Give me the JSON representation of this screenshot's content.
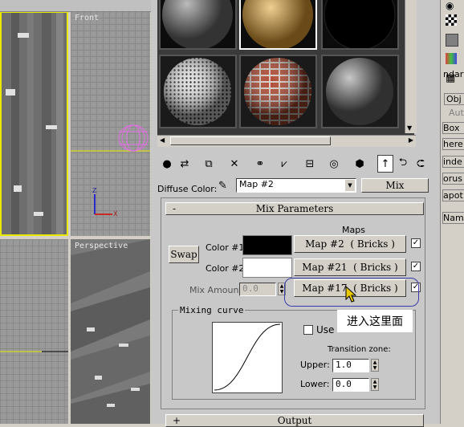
{
  "viewports": {
    "front_label": "Front",
    "perspective_label": "Perspective",
    "axis_z": "Z",
    "axis_x": "X"
  },
  "material_editor": {
    "slots": [
      {
        "name": "stone-sphere"
      },
      {
        "name": "wood-sphere"
      },
      {
        "name": "black-sphere"
      },
      {
        "name": "dotted-sphere"
      },
      {
        "name": "brick-sphere"
      },
      {
        "name": "gray-sphere"
      }
    ],
    "diffuse_label": "Diffuse Color:",
    "diffuse_value": "Map #2",
    "map_type_button": "Mix"
  },
  "rollout": {
    "title": "Mix Parameters",
    "collapse_symbol": "-",
    "maps_header": "Maps",
    "swap_label": "Swap",
    "color1_label": "Color #1",
    "color1_map": "Map #2  ( Bricks )",
    "color1_swatch": "#000000",
    "color2_label": "Color #2",
    "color2_map": "Map #21  ( Bricks )",
    "color2_swatch": "#ffffff",
    "mix_amount_label": "Mix Amount:",
    "mix_amount_value": "0.0",
    "mix_map": "Map #17  ( Bricks )",
    "mixing_curve_label": "Mixing curve",
    "use_curve_label": "Use",
    "annotation": "进入这里面",
    "transition_label": "Transition zone:",
    "upper_label": "Upper:",
    "upper_value": "1.0",
    "lower_label": "Lower:",
    "lower_value": "0.0",
    "output_title": "Output",
    "output_symbol": "+"
  },
  "right_panel": {
    "items": [
      "ndar",
      "Obj",
      "Aut",
      "Box",
      "here",
      "inde",
      "orus",
      "apot",
      "Name"
    ]
  },
  "colors": {
    "annotation_ring": "#3a3aaa",
    "selection_yellow": "#e8e800",
    "torus_pink": "#e070e0"
  }
}
